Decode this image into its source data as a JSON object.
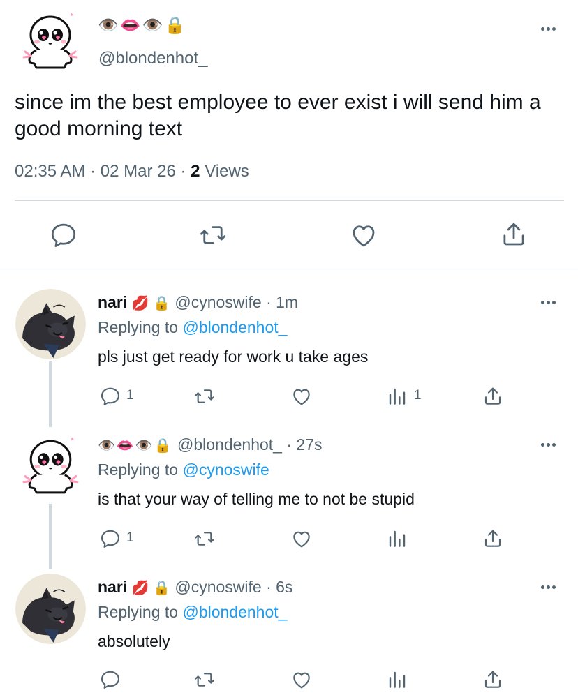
{
  "main_tweet": {
    "author_name": "👁️👄👁️🔒",
    "handle": "@blondenhot_",
    "text": "since im the best employee to ever exist i will send him a good morning text",
    "time": "02:35 AM",
    "date": "02 Mar 26",
    "views_count": "2",
    "views_label": "Views",
    "actions": [
      "reply-icon",
      "retweet-icon",
      "like-icon",
      "share-icon"
    ]
  },
  "replies": [
    {
      "name": "nari",
      "name_emoji": "💋 🔒",
      "handle_time": "@cynoswife · 1m",
      "replying_prefix": "Replying to",
      "replying_handle": "@blondenhot_",
      "text": "pls just get ready for work u take ages",
      "reply_count": "1",
      "views_count": "1"
    },
    {
      "name": "👁️👄👁️🔒",
      "handle_time": "@blondenhot_ · 27s",
      "replying_prefix": "Replying to",
      "replying_handle": "@cynoswife",
      "text": "is that your way of telling me to not be stupid",
      "reply_count": "1"
    },
    {
      "name": "nari",
      "name_emoji": "💋 🔒",
      "handle_time": "@cynoswife · 6s",
      "replying_prefix": "Replying to",
      "replying_handle": "@blondenhot_",
      "text": "absolutely"
    }
  ],
  "colors": {
    "text": "#0f1419",
    "secondary": "#536471",
    "link": "#1d9bf0",
    "divider": "#cfd9de"
  }
}
